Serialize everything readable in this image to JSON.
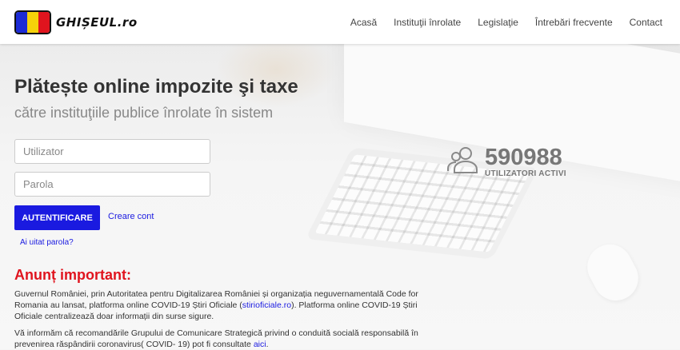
{
  "brand": {
    "name": "GHIȘEUL.ro",
    "flag_colors": [
      "#1c2bd6",
      "#f5d20a",
      "#e0141e"
    ]
  },
  "nav": {
    "items": [
      "Acasă",
      "Instituţii înrolate",
      "Legislaţie",
      "Întrebări frecvente",
      "Contact"
    ]
  },
  "hero": {
    "title": "Plătește online impozite şi taxe",
    "subtitle": "către instituţiile publice înrolate în sistem"
  },
  "login": {
    "user_placeholder": "Utilizator",
    "password_placeholder": "Parola",
    "submit_label": "AUTENTIFICARE",
    "create_account": "Creare cont",
    "forgot_password": "Ai uitat parola?"
  },
  "stats": {
    "users_count": "590988",
    "users_label": "UTILIZATORI ACTIVI",
    "icon": "users-icon"
  },
  "announcement": {
    "title": "Anunț important:",
    "p1_a": "Guvernul României, prin Autoritatea pentru Digitalizarea României și organizația neguvernamentală Code for Romania au lansat, platforma online COVID-19 Știri Oficiale (",
    "p1_link": "stirioficiale.ro",
    "p1_b": "). Platforma online COVID-19 Știri Oficiale centralizează doar informații din surse sigure.",
    "p2_a": "Vă informăm că recomandările Grupului de Comunicare Strategică privind o conduită socială responsabilă în prevenirea răspândirii coronavirus( COVID- 19) pot fi consultate ",
    "p2_link": "aici",
    "p2_b": "."
  },
  "colors": {
    "accent": "#1a1ae0",
    "alert": "#e0141e"
  }
}
